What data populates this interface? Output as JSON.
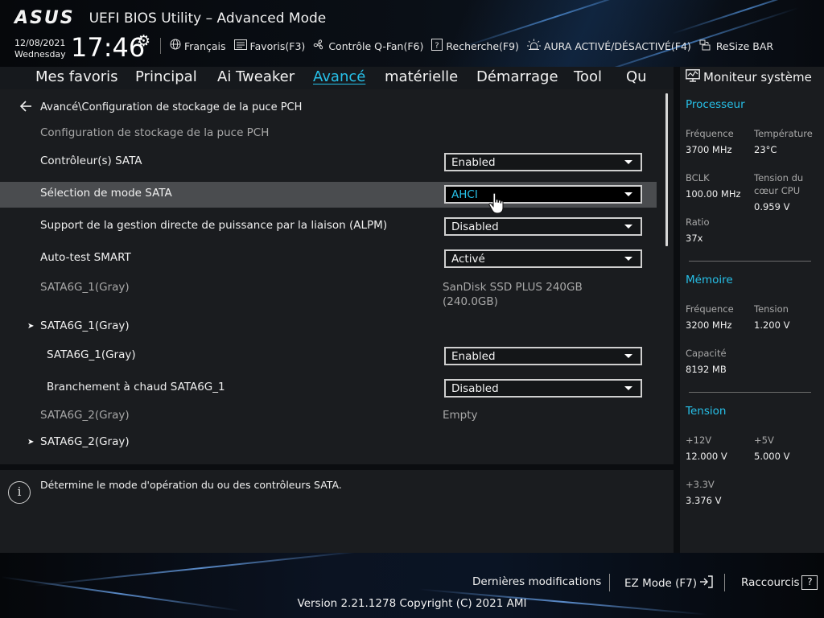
{
  "header": {
    "logo": "ASUS",
    "title": "UEFI BIOS Utility – Advanced Mode",
    "date": "12/08/2021",
    "weekday": "Wednesday",
    "time": "17:46",
    "toolbar": [
      {
        "id": "language",
        "icon": "globe-icon",
        "label": "Français"
      },
      {
        "id": "favorites",
        "icon": "favorites-icon",
        "label": "Favoris(F3)"
      },
      {
        "id": "qfan",
        "icon": "fan-icon",
        "label": "Contrôle Q-Fan(F6)"
      },
      {
        "id": "search",
        "icon": "search-help-icon",
        "label": "Recherche(F9)"
      },
      {
        "id": "aura",
        "icon": "aura-icon",
        "label": "AURA ACTIVÉ/DÉSACTIVÉ(F4)"
      },
      {
        "id": "resizebar",
        "icon": "resize-bar-icon",
        "label": "ReSize BAR"
      }
    ]
  },
  "tabs": [
    {
      "label": "Mes favoris",
      "active": false
    },
    {
      "label": "Principal",
      "active": false
    },
    {
      "label": "Ai Tweaker",
      "active": false
    },
    {
      "label": "Avancé",
      "active": true
    },
    {
      "label": "matérielle",
      "active": false
    },
    {
      "label": "Démarrage",
      "active": false
    },
    {
      "label": "Tool",
      "active": false
    },
    {
      "label": "Qu",
      "active": false
    }
  ],
  "main": {
    "breadcrumb": "Avancé\\Configuration de stockage de la puce PCH",
    "section_title": "Configuration de stockage de la puce PCH",
    "rows": {
      "sata_controller": {
        "label": "Contrôleur(s) SATA",
        "value": "Enabled"
      },
      "sata_mode": {
        "label": "Sélection de mode SATA",
        "value": "AHCI"
      },
      "alpm": {
        "label": "Support de la gestion directe de puissance par la liaison (ALPM)",
        "value": "Disabled"
      },
      "smart": {
        "label": "Auto-test SMART",
        "value": "Activé"
      },
      "sata1_info": {
        "label": "SATA6G_1(Gray)",
        "value_line1": "SanDisk SSD PLUS 240GB",
        "value_line2": "(240.0GB)"
      },
      "sata1_submenu": {
        "label": "SATA6G_1(Gray)"
      },
      "sata1_port": {
        "label": "SATA6G_1(Gray)",
        "value": "Enabled"
      },
      "sata1_hotplug": {
        "label": "Branchement à chaud SATA6G_1",
        "value": "Disabled"
      },
      "sata2_info": {
        "label": "SATA6G_2(Gray)",
        "value": "Empty"
      },
      "sata2_submenu": {
        "label": "SATA6G_2(Gray)"
      }
    }
  },
  "help": {
    "text": "Détermine le mode d'opération du ou des contrôleurs SATA."
  },
  "monitor": {
    "title": "Moniteur système",
    "processor": {
      "heading": "Processeur",
      "freq_label": "Fréquence",
      "freq_value": "3700 MHz",
      "temp_label": "Température",
      "temp_value": "23°C",
      "bclk_label": "BCLK",
      "bclk_value": "100.00 MHz",
      "vcore_label_1": "Tension du",
      "vcore_label_2": "cœur CPU",
      "vcore_value": "0.959 V",
      "ratio_label": "Ratio",
      "ratio_value": "37x"
    },
    "memory": {
      "heading": "Mémoire",
      "freq_label": "Fréquence",
      "freq_value": "3200 MHz",
      "volt_label": "Tension",
      "volt_value": "1.200 V",
      "cap_label": "Capacité",
      "cap_value": "8192 MB"
    },
    "voltage": {
      "heading": "Tension",
      "v12_label": "+12V",
      "v12_value": "12.000 V",
      "v5_label": "+5V",
      "v5_value": "5.000 V",
      "v33_label": "+3.3V",
      "v33_value": "3.376 V"
    }
  },
  "footer": {
    "last_mods": "Dernières modifications",
    "ez_mode": "EZ Mode (F7)",
    "shortcuts": "Raccourcis",
    "shortcuts_key": "?",
    "version": "Version 2.21.1278 Copyright (C) 2021 AMI"
  },
  "colors": {
    "accent": "#27c0e8",
    "highlight_row": "#4a4c4f",
    "panel": "#1a1c1f"
  }
}
